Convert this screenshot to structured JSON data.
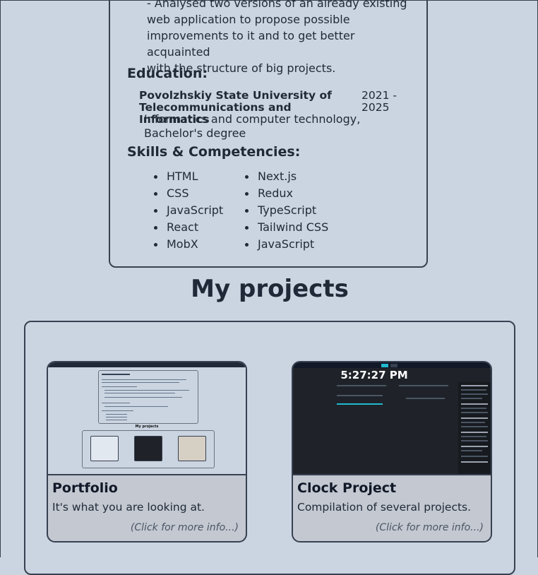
{
  "experience": {
    "lines": [
      "- Analysed two versions of an already existing",
      "web application to propose possible",
      "improvements to it and to get better acquainted",
      "with the structure of big projects."
    ]
  },
  "education": {
    "heading": "Education:",
    "school": "Povolzhskiy State University of Telecommunications and Informatics",
    "years": "2021 - 2025",
    "degree": "Informatics and computer technology, Bachelor's degree"
  },
  "skills": {
    "heading": "Skills & Competencies:",
    "col1": [
      "HTML",
      "CSS",
      "JavaScript",
      "React",
      "MobX"
    ],
    "col2": [
      "Next.js",
      "Redux",
      "TypeScript",
      "Tailwind CSS",
      "JavaScript"
    ]
  },
  "projects": {
    "heading": "My projects",
    "cards": [
      {
        "title": "Portfolio",
        "desc": "It's what you are looking at.",
        "more": "(Click for more info...)",
        "thumb": {
          "mini_title": "My projects"
        }
      },
      {
        "title": "Clock Project",
        "desc": "Compilation of several projects.",
        "more": "(Click for more info...)",
        "thumb": {
          "clock": "5:27:27 PM"
        }
      }
    ]
  }
}
